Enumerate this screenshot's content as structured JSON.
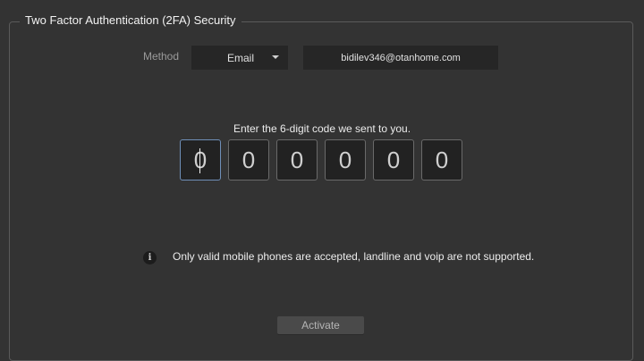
{
  "section": {
    "title": "Two Factor Authentication (2FA) Security"
  },
  "method": {
    "label": "Method",
    "selected": "Email"
  },
  "contact": {
    "value": "bidilev346@otanhome.com"
  },
  "code": {
    "prompt": "Enter the 6-digit code we sent to you.",
    "digits": [
      "0",
      "0",
      "0",
      "0",
      "0",
      "0"
    ]
  },
  "info": {
    "icon": "info-icon",
    "icon_glyph": "i",
    "text": "Only valid mobile phones are accepted, landline and voip are not supported."
  },
  "actions": {
    "activate_label": "Activate"
  }
}
